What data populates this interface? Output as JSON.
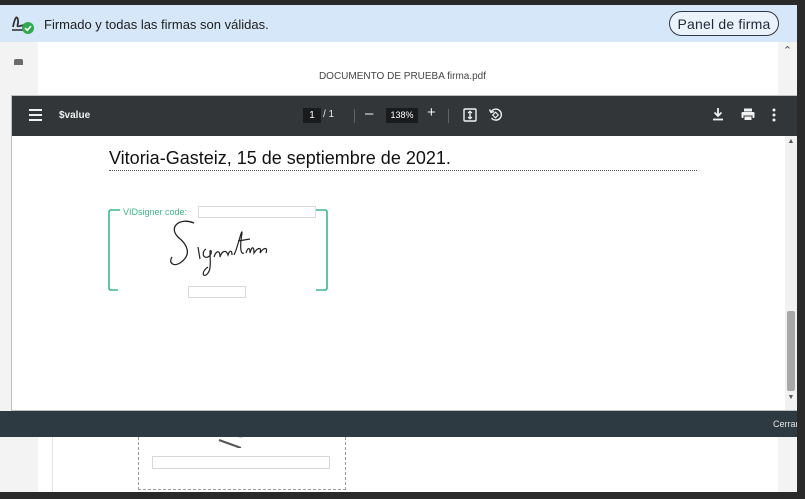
{
  "signature_banner": {
    "status_text": "Firmado y todas las firmas son válidas.",
    "panel_button": "Panel de firma",
    "icon": "signature-valid-icon"
  },
  "viewer": {
    "document_title": "DOCUMENTO DE PRUEBA firma.pdf",
    "toolbar": {
      "title": "$value",
      "current_page": "1",
      "page_of": "/  1",
      "zoom": "138%",
      "menu_icon": "hamburger-menu-icon",
      "zoom_out_icon": "minus-icon",
      "zoom_in_icon": "plus-icon",
      "fit_icon": "fit-page-icon",
      "rotate_icon": "rotate-icon",
      "download_icon": "download-icon",
      "print_icon": "print-icon",
      "more_icon": "more-vertical-icon"
    },
    "page": {
      "place_date": "Vitoria-Gasteiz, 15 de septiembre de 2021.",
      "signature_code_label": "VIDsigner code:",
      "signature_image": "handwritten-signature"
    }
  },
  "close_bar": {
    "close_label": "Cerrar"
  },
  "colors": {
    "banner_bg": "#d6e7f9",
    "toolbar_bg": "#323639",
    "signature_frame": "#3db887",
    "close_bar_bg": "#2d3a41"
  }
}
